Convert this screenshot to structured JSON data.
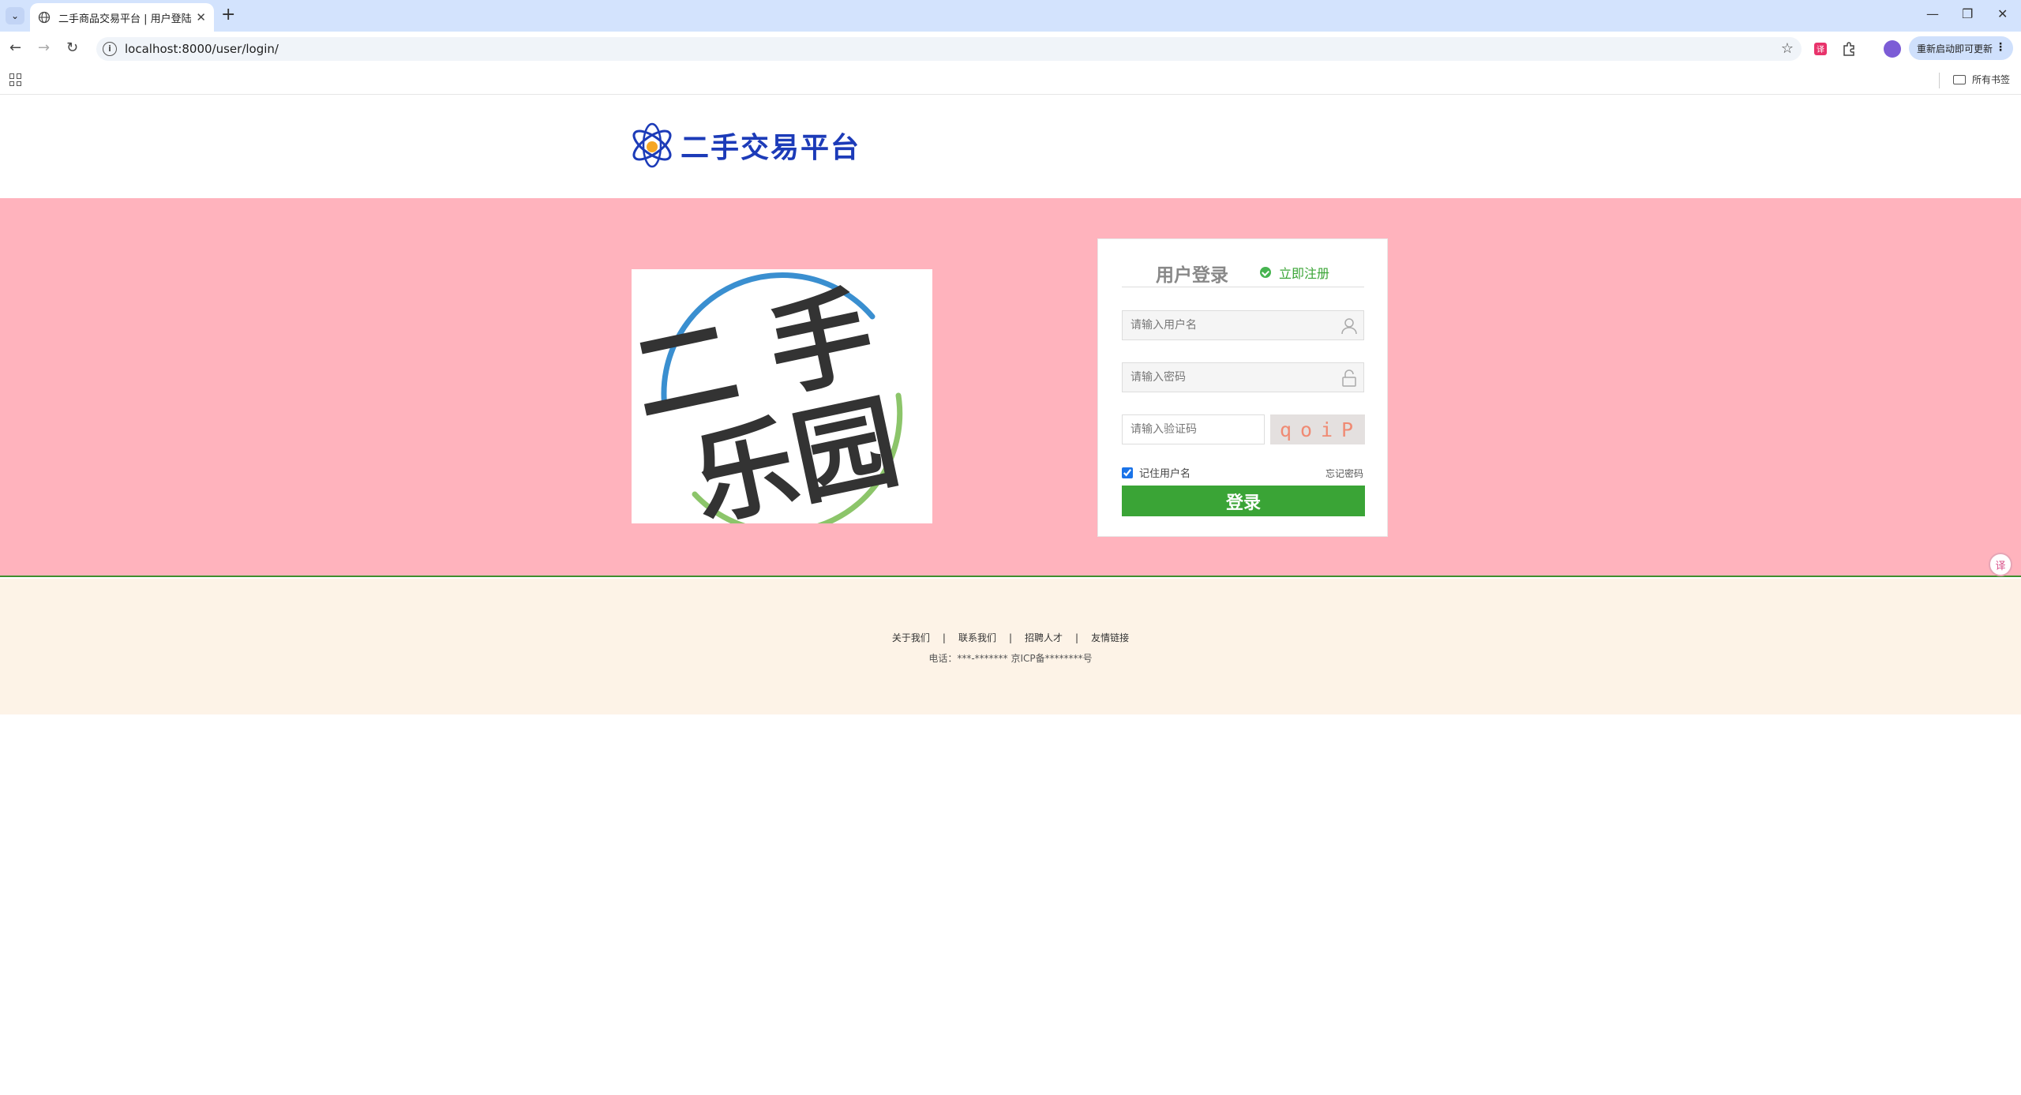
{
  "browser": {
    "tab_title": "二手商品交易平台 | 用户登陆",
    "url": "localhost:8000/user/login/",
    "update_label": "重新启动即可更新",
    "all_bookmarks": "所有书签"
  },
  "header": {
    "logo_text": "二手交易平台"
  },
  "promo": {
    "line1": "二 手",
    "line2": "乐园"
  },
  "login": {
    "title": "用户登录",
    "register_link": "立即注册",
    "username_placeholder": "请输入用户名",
    "password_placeholder": "请输入密码",
    "captcha_placeholder": "请输入验证码",
    "captcha_chars": [
      "q",
      "o",
      "i",
      "P"
    ],
    "remember_label": "记住用户名",
    "remember_checked": true,
    "forgot_label": "忘记密码",
    "submit_label": "登录"
  },
  "footer": {
    "links": [
      "关于我们",
      "联系我们",
      "招聘人才",
      "友情链接"
    ],
    "info": "电话：***-******* 京ICP备********号"
  },
  "colors": {
    "banner_bg": "#ffb3bd",
    "brand_green": "#3aa436",
    "logo_blue": "#1c3bb8",
    "footer_bg": "#fdf3e7"
  }
}
